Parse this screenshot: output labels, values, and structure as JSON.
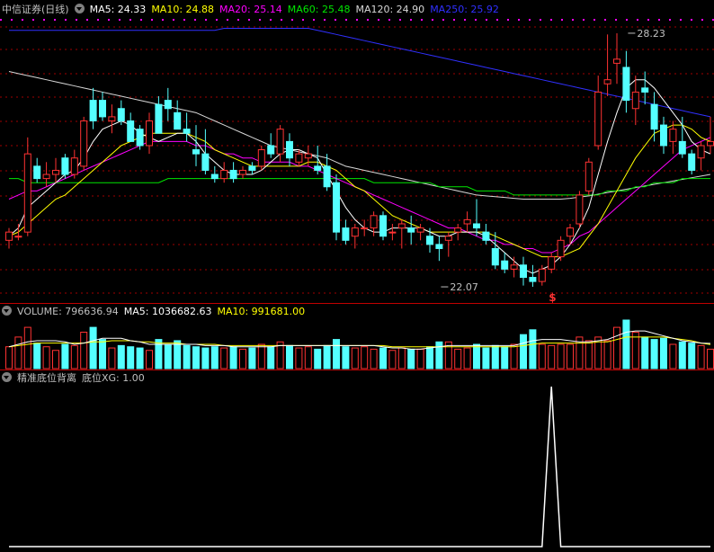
{
  "colors": {
    "up": "#ff3232",
    "down": "#54ffff",
    "ma5": "#ffffff",
    "ma10": "#ffff00",
    "ma20": "#ff00ff",
    "ma60": "#00e600",
    "ma120": "#d8d8d8",
    "ma250": "#3030ff",
    "grid": "#a00000",
    "signal": "#ffffff"
  },
  "price_header": {
    "title": "中信证券(日线)",
    "ma5": "MA5: 24.33",
    "ma10": "MA10: 24.88",
    "ma20": "MA20: 25.14",
    "ma60": "MA60: 25.48",
    "ma120": "MA120: 24.90",
    "ma250": "MA250: 25.92"
  },
  "volume_header": {
    "volume": "VOLUME: 796636.94",
    "ma5": "MA5: 1036682.63",
    "ma10": "MA10: 991681.00"
  },
  "indicator_header": {
    "name": "精准底位背离",
    "value": "底位XG: 1.00"
  },
  "annotations": {
    "high_label": "28.23",
    "low_label": "22.07",
    "signal_mark": "$"
  },
  "chart_data": [
    {
      "type": "candlestick",
      "title": "中信证券(日线)",
      "ylim": [
        21.7,
        28.6
      ],
      "high_mark": {
        "index": 66,
        "value": 28.23
      },
      "low_mark": {
        "index": 46,
        "value": 22.07
      },
      "signal_index": 58,
      "ohlc": [
        [
          23.2,
          23.5,
          23.0,
          23.4
        ],
        [
          23.3,
          23.6,
          23.2,
          23.3
        ],
        [
          23.4,
          25.7,
          23.3,
          25.3
        ],
        [
          25.0,
          25.2,
          24.6,
          24.7
        ],
        [
          24.7,
          25.1,
          24.5,
          24.8
        ],
        [
          24.8,
          25.2,
          24.6,
          24.9
        ],
        [
          25.2,
          25.3,
          24.7,
          24.8
        ],
        [
          24.8,
          25.4,
          24.7,
          25.2
        ],
        [
          25.0,
          26.2,
          24.9,
          26.1
        ],
        [
          26.6,
          26.9,
          25.9,
          26.1
        ],
        [
          26.6,
          26.8,
          26.1,
          26.2
        ],
        [
          26.1,
          26.5,
          25.8,
          26.2
        ],
        [
          26.4,
          26.6,
          26.0,
          26.1
        ],
        [
          26.1,
          26.3,
          25.6,
          25.6
        ],
        [
          25.9,
          26.0,
          25.4,
          25.5
        ],
        [
          25.5,
          26.3,
          25.3,
          26.1
        ],
        [
          26.5,
          26.7,
          25.8,
          25.8
        ],
        [
          26.6,
          26.9,
          26.1,
          26.4
        ],
        [
          26.3,
          26.6,
          25.9,
          25.9
        ],
        [
          25.9,
          26.3,
          25.6,
          25.8
        ],
        [
          25.4,
          26.0,
          25.0,
          25.3
        ],
        [
          25.3,
          25.9,
          24.8,
          24.9
        ],
        [
          24.8,
          25.0,
          24.6,
          24.7
        ],
        [
          24.7,
          25.1,
          24.6,
          24.9
        ],
        [
          24.9,
          25.1,
          24.6,
          24.7
        ],
        [
          24.8,
          25.0,
          24.7,
          24.9
        ],
        [
          25.0,
          25.1,
          24.8,
          24.9
        ],
        [
          25.0,
          25.5,
          24.9,
          25.4
        ],
        [
          25.5,
          25.8,
          25.2,
          25.3
        ],
        [
          25.3,
          26.0,
          25.1,
          25.9
        ],
        [
          25.6,
          25.8,
          25.0,
          25.2
        ],
        [
          25.1,
          25.4,
          25.0,
          25.3
        ],
        [
          25.2,
          25.5,
          25.0,
          25.3
        ],
        [
          25.0,
          25.5,
          24.8,
          24.9
        ],
        [
          25.0,
          25.3,
          24.4,
          24.5
        ],
        [
          24.6,
          24.8,
          23.2,
          23.4
        ],
        [
          23.5,
          23.7,
          23.1,
          23.2
        ],
        [
          23.3,
          23.6,
          23.0,
          23.5
        ],
        [
          23.5,
          23.7,
          23.3,
          23.5
        ],
        [
          23.5,
          23.9,
          23.3,
          23.8
        ],
        [
          23.8,
          23.9,
          23.2,
          23.3
        ],
        [
          23.4,
          23.6,
          23.2,
          23.4
        ],
        [
          23.5,
          23.7,
          23.0,
          23.6
        ],
        [
          23.5,
          23.8,
          23.1,
          23.4
        ],
        [
          23.4,
          23.6,
          23.2,
          23.5
        ],
        [
          23.3,
          23.5,
          22.9,
          23.1
        ],
        [
          23.1,
          23.3,
          22.7,
          23.0
        ],
        [
          23.2,
          23.4,
          22.8,
          23.3
        ],
        [
          23.4,
          23.6,
          23.2,
          23.5
        ],
        [
          23.6,
          23.9,
          23.4,
          23.7
        ],
        [
          23.6,
          24.2,
          23.3,
          23.5
        ],
        [
          23.4,
          23.6,
          23.1,
          23.2
        ],
        [
          23.0,
          23.4,
          22.5,
          22.6
        ],
        [
          22.7,
          22.9,
          22.4,
          22.5
        ],
        [
          22.5,
          22.8,
          22.3,
          22.6
        ],
        [
          22.6,
          22.8,
          22.1,
          22.3
        ],
        [
          22.3,
          22.6,
          22.07,
          22.2
        ],
        [
          22.2,
          22.6,
          22.1,
          22.5
        ],
        [
          22.5,
          22.9,
          22.4,
          22.8
        ],
        [
          22.8,
          23.3,
          22.7,
          23.2
        ],
        [
          23.3,
          23.6,
          23.1,
          23.5
        ],
        [
          23.6,
          24.4,
          23.5,
          24.3
        ],
        [
          24.4,
          25.2,
          24.3,
          25.1
        ],
        [
          25.5,
          27.2,
          25.4,
          26.8
        ],
        [
          27.0,
          28.2,
          26.7,
          27.1
        ],
        [
          27.5,
          28.23,
          27.0,
          27.6
        ],
        [
          27.4,
          27.8,
          26.3,
          26.6
        ],
        [
          26.4,
          27.2,
          26.0,
          26.8
        ],
        [
          26.9,
          27.3,
          26.5,
          26.8
        ],
        [
          26.5,
          26.8,
          25.6,
          25.9
        ],
        [
          26.0,
          26.2,
          25.3,
          25.5
        ],
        [
          25.6,
          26.1,
          25.3,
          25.9
        ],
        [
          25.6,
          26.2,
          25.2,
          25.3
        ],
        [
          25.3,
          25.4,
          24.8,
          24.9
        ],
        [
          25.2,
          25.6,
          24.9,
          25.5
        ],
        [
          25.5,
          26.2,
          25.3,
          25.6
        ]
      ],
      "ma5": [
        23.3,
        23.5,
        24.0,
        24.2,
        24.4,
        24.6,
        24.8,
        24.9,
        25.2,
        25.6,
        25.9,
        26.0,
        26.1,
        26.0,
        25.8,
        25.7,
        25.6,
        25.7,
        25.8,
        25.8,
        25.6,
        25.3,
        25.1,
        24.9,
        24.8,
        24.8,
        24.8,
        24.9,
        25.1,
        25.3,
        25.4,
        25.4,
        25.3,
        25.2,
        24.8,
        24.4,
        24.0,
        23.7,
        23.5,
        23.4,
        23.4,
        23.5,
        23.5,
        23.5,
        23.5,
        23.4,
        23.3,
        23.3,
        23.4,
        23.4,
        23.4,
        23.3,
        23.1,
        22.9,
        22.7,
        22.5,
        22.4,
        22.5,
        22.6,
        22.8,
        23.1,
        23.5,
        24.0,
        24.8,
        25.6,
        26.3,
        26.9,
        27.1,
        27.1,
        26.9,
        26.6,
        26.3,
        26.0,
        25.6,
        25.4,
        25.3
      ],
      "ma10": [
        23.3,
        23.4,
        23.6,
        23.8,
        24.0,
        24.2,
        24.3,
        24.5,
        24.7,
        24.9,
        25.1,
        25.3,
        25.5,
        25.6,
        25.7,
        25.8,
        25.8,
        25.8,
        25.8,
        25.8,
        25.7,
        25.6,
        25.4,
        25.3,
        25.2,
        25.1,
        25.0,
        25.0,
        25.0,
        25.0,
        25.0,
        25.0,
        25.1,
        25.1,
        25.0,
        24.9,
        24.7,
        24.5,
        24.4,
        24.2,
        24.0,
        23.8,
        23.7,
        23.6,
        23.5,
        23.4,
        23.4,
        23.4,
        23.4,
        23.4,
        23.4,
        23.4,
        23.3,
        23.2,
        23.1,
        23.0,
        22.9,
        22.8,
        22.8,
        22.8,
        22.9,
        23.0,
        23.3,
        23.6,
        24.0,
        24.4,
        24.8,
        25.2,
        25.5,
        25.8,
        25.9,
        26.0,
        26.0,
        25.9,
        25.7,
        25.6
      ],
      "ma20": [
        24.2,
        24.3,
        24.4,
        24.4,
        24.5,
        24.6,
        24.7,
        24.8,
        24.9,
        25.0,
        25.1,
        25.2,
        25.3,
        25.4,
        25.5,
        25.6,
        25.6,
        25.6,
        25.6,
        25.6,
        25.5,
        25.5,
        25.4,
        25.3,
        25.3,
        25.2,
        25.2,
        25.1,
        25.1,
        25.1,
        25.1,
        25.0,
        25.0,
        24.9,
        24.8,
        24.7,
        24.6,
        24.5,
        24.4,
        24.3,
        24.2,
        24.1,
        24.0,
        23.9,
        23.8,
        23.7,
        23.6,
        23.5,
        23.5,
        23.4,
        23.3,
        23.2,
        23.2,
        23.1,
        23.1,
        23.0,
        23.0,
        22.9,
        22.9,
        23.0,
        23.1,
        23.3,
        23.4,
        23.6,
        23.8,
        24.0,
        24.2,
        24.4,
        24.6,
        24.8,
        25.0,
        25.2,
        25.4,
        25.5,
        25.6,
        25.7
      ],
      "ma60": [
        24.7,
        24.7,
        24.6,
        24.6,
        24.6,
        24.6,
        24.6,
        24.6,
        24.6,
        24.6,
        24.6,
        24.6,
        24.6,
        24.6,
        24.6,
        24.6,
        24.6,
        24.7,
        24.7,
        24.7,
        24.7,
        24.7,
        24.7,
        24.7,
        24.7,
        24.7,
        24.7,
        24.7,
        24.7,
        24.7,
        24.7,
        24.7,
        24.7,
        24.7,
        24.7,
        24.7,
        24.7,
        24.7,
        24.7,
        24.6,
        24.6,
        24.6,
        24.6,
        24.6,
        24.6,
        24.6,
        24.5,
        24.5,
        24.5,
        24.5,
        24.4,
        24.4,
        24.4,
        24.4,
        24.3,
        24.3,
        24.3,
        24.3,
        24.3,
        24.3,
        24.3,
        24.3,
        24.3,
        24.3,
        24.4,
        24.4,
        24.4,
        24.5,
        24.5,
        24.6,
        24.6,
        24.6,
        24.7,
        24.7,
        24.7,
        24.7
      ],
      "ma120": [
        27.3,
        27.25,
        27.2,
        27.15,
        27.1,
        27.05,
        27.0,
        26.95,
        26.9,
        26.85,
        26.8,
        26.75,
        26.7,
        26.65,
        26.6,
        26.55,
        26.5,
        26.45,
        26.4,
        26.35,
        26.3,
        26.2,
        26.1,
        26.0,
        25.9,
        25.8,
        25.7,
        25.6,
        25.5,
        25.45,
        25.4,
        25.35,
        25.3,
        25.25,
        25.2,
        25.1,
        25.0,
        24.95,
        24.9,
        24.85,
        24.8,
        24.75,
        24.7,
        24.65,
        24.6,
        24.55,
        24.5,
        24.45,
        24.4,
        24.35,
        24.3,
        24.28,
        24.26,
        24.24,
        24.22,
        24.2,
        24.2,
        24.2,
        24.2,
        24.2,
        24.22,
        24.25,
        24.28,
        24.32,
        24.36,
        24.4,
        24.44,
        24.48,
        24.52,
        24.56,
        24.6,
        24.64,
        24.68,
        24.72,
        24.76,
        24.8
      ],
      "ma250": [
        28.3,
        28.3,
        28.3,
        28.3,
        28.3,
        28.3,
        28.3,
        28.3,
        28.3,
        28.3,
        28.3,
        28.3,
        28.3,
        28.3,
        28.3,
        28.3,
        28.3,
        28.3,
        28.3,
        28.3,
        28.3,
        28.3,
        28.3,
        28.35,
        28.35,
        28.35,
        28.35,
        28.35,
        28.35,
        28.35,
        28.35,
        28.35,
        28.35,
        28.3,
        28.25,
        28.2,
        28.15,
        28.1,
        28.05,
        28.0,
        27.95,
        27.9,
        27.85,
        27.8,
        27.75,
        27.7,
        27.65,
        27.6,
        27.55,
        27.5,
        27.45,
        27.4,
        27.35,
        27.3,
        27.25,
        27.2,
        27.15,
        27.1,
        27.05,
        27.0,
        26.95,
        26.9,
        26.85,
        26.8,
        26.75,
        26.7,
        26.65,
        26.6,
        26.55,
        26.5,
        26.45,
        26.4,
        26.35,
        26.3,
        26.25,
        26.2
      ]
    },
    {
      "type": "bar",
      "title": "VOLUME",
      "ylim": [
        0,
        2000000
      ],
      "values": [
        900000,
        1300000,
        1700000,
        1050000,
        900000,
        750000,
        1000000,
        950000,
        1500000,
        1700000,
        1200000,
        850000,
        950000,
        900000,
        850000,
        750000,
        1200000,
        1000000,
        1150000,
        950000,
        900000,
        850000,
        900000,
        850000,
        900000,
        800000,
        850000,
        1000000,
        900000,
        1100000,
        950000,
        850000,
        900000,
        800000,
        950000,
        1200000,
        900000,
        850000,
        900000,
        800000,
        850000,
        750000,
        850000,
        800000,
        800000,
        900000,
        1100000,
        1100000,
        800000,
        850000,
        1000000,
        850000,
        950000,
        900000,
        1000000,
        1400000,
        1600000,
        1000000,
        950000,
        1000000,
        1000000,
        1300000,
        1150000,
        1300000,
        1150000,
        1700000,
        2000000,
        1500000,
        1300000,
        1200000,
        1250000,
        1000000,
        1100000,
        1050000,
        950000,
        800000
      ],
      "ma5": [
        900000,
        1000000,
        1100000,
        1150000,
        1150000,
        1150000,
        1100000,
        1000000,
        1050000,
        1150000,
        1250000,
        1250000,
        1250000,
        1150000,
        1100000,
        1000000,
        1000000,
        1000000,
        1000000,
        1000000,
        1000000,
        950000,
        950000,
        950000,
        900000,
        900000,
        900000,
        900000,
        900000,
        950000,
        950000,
        950000,
        950000,
        950000,
        950000,
        950000,
        950000,
        950000,
        950000,
        950000,
        900000,
        850000,
        850000,
        800000,
        800000,
        850000,
        900000,
        950000,
        950000,
        950000,
        950000,
        950000,
        950000,
        950000,
        950000,
        1050000,
        1150000,
        1200000,
        1200000,
        1200000,
        1150000,
        1100000,
        1100000,
        1150000,
        1200000,
        1350000,
        1500000,
        1550000,
        1550000,
        1450000,
        1350000,
        1250000,
        1150000,
        1100000,
        1050000,
        1036682.63
      ],
      "ma10": [
        900000,
        950000,
        1000000,
        1050000,
        1050000,
        1050000,
        1050000,
        1050000,
        1050000,
        1100000,
        1100000,
        1150000,
        1150000,
        1150000,
        1100000,
        1100000,
        1050000,
        1050000,
        1050000,
        1000000,
        1000000,
        1000000,
        1000000,
        950000,
        950000,
        950000,
        950000,
        950000,
        950000,
        950000,
        950000,
        950000,
        950000,
        950000,
        950000,
        950000,
        950000,
        950000,
        950000,
        950000,
        950000,
        900000,
        900000,
        900000,
        900000,
        900000,
        900000,
        900000,
        900000,
        900000,
        900000,
        900000,
        900000,
        900000,
        900000,
        950000,
        1000000,
        1050000,
        1050000,
        1050000,
        1050000,
        1050000,
        1050000,
        1100000,
        1100000,
        1200000,
        1300000,
        1300000,
        1300000,
        1300000,
        1300000,
        1250000,
        1200000,
        1150000,
        1050000,
        991681.0
      ]
    },
    {
      "type": "line",
      "title": "精准底位背离",
      "ylim": [
        0,
        1
      ],
      "series": [
        {
          "name": "底位XG",
          "signal_index": 58,
          "value": 1.0
        }
      ]
    }
  ]
}
